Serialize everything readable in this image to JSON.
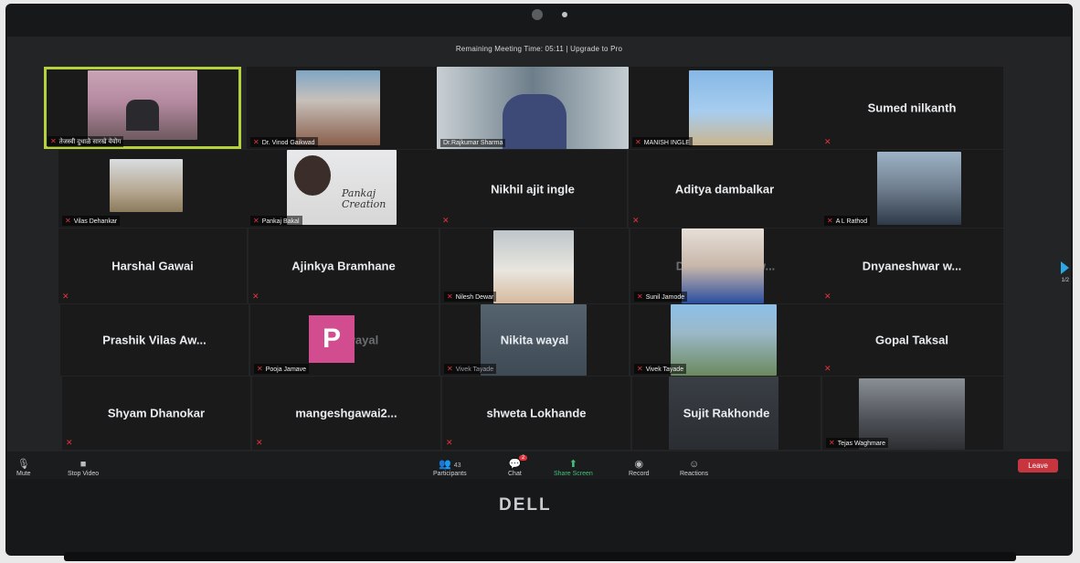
{
  "banner": "Remaining Meeting Time: 05:11 | Upgrade to Pro",
  "tiles": {
    "t1": {
      "label": "तेजस्वी दुधाळे सारखे येयोग"
    },
    "t2": {
      "label": "Dr. Vinod Gaikwad"
    },
    "t3": {
      "label": "Dr.Rajkumar Sharma"
    },
    "t4": {
      "label": "MANISH INGLE"
    },
    "t5": {
      "name": "Sumed nilkanth"
    },
    "t6": {
      "label": "Vilas Dehankar"
    },
    "t7": {
      "label": "Pankaj Bakal",
      "overlay": "Pankaj Creation"
    },
    "t8": {
      "name": "Nikhil ajit ingle"
    },
    "t9": {
      "name": "Aditya dambalkar"
    },
    "t10": {
      "label": "A L Rathod"
    },
    "t11": {
      "name": "Harshal Gawai"
    },
    "t12": {
      "name": "Ajinkya Bramhane"
    },
    "t13": {
      "label": "Nilesh Dewar"
    },
    "t14": {
      "label": "Sunil Jamode",
      "faded": "Dnyaneshwar w..."
    },
    "t15": {
      "name": "Dnyaneshwar w..."
    },
    "t16": {
      "name": "Prashik Vilas Aw..."
    },
    "t17": {
      "label": "Pooja Jamave",
      "avatar": "P",
      "faded": "Nikita wayal"
    },
    "t18": {
      "name": "Nikita wayal",
      "label": "Vivek Tayade"
    },
    "t19": {
      "label": "Vivek Tayade"
    },
    "t20": {
      "name": "Gopal Taksal"
    },
    "t21": {
      "name": "Shyam Dhanokar"
    },
    "t22": {
      "name": "mangeshgawai2..."
    },
    "t23": {
      "name": "shweta Lokhande"
    },
    "t24": {
      "name": "Sujit Rakhonde"
    },
    "t25": {
      "label": "Tejas Waghmare"
    }
  },
  "toolbar": {
    "mute": "Mute",
    "stop_video": "Stop Video",
    "participants": "Participants",
    "participants_count": "43",
    "chat": "Chat",
    "chat_badge": "2",
    "share_screen": "Share Screen",
    "record": "Record",
    "reactions": "Reactions",
    "leave": "Leave"
  },
  "pagination": "1/2",
  "brand": "DELL",
  "colors": {
    "active_speaker": "#b6d23a",
    "leave": "#c7353f",
    "share": "#45c07a",
    "muted": "#e3343a"
  }
}
